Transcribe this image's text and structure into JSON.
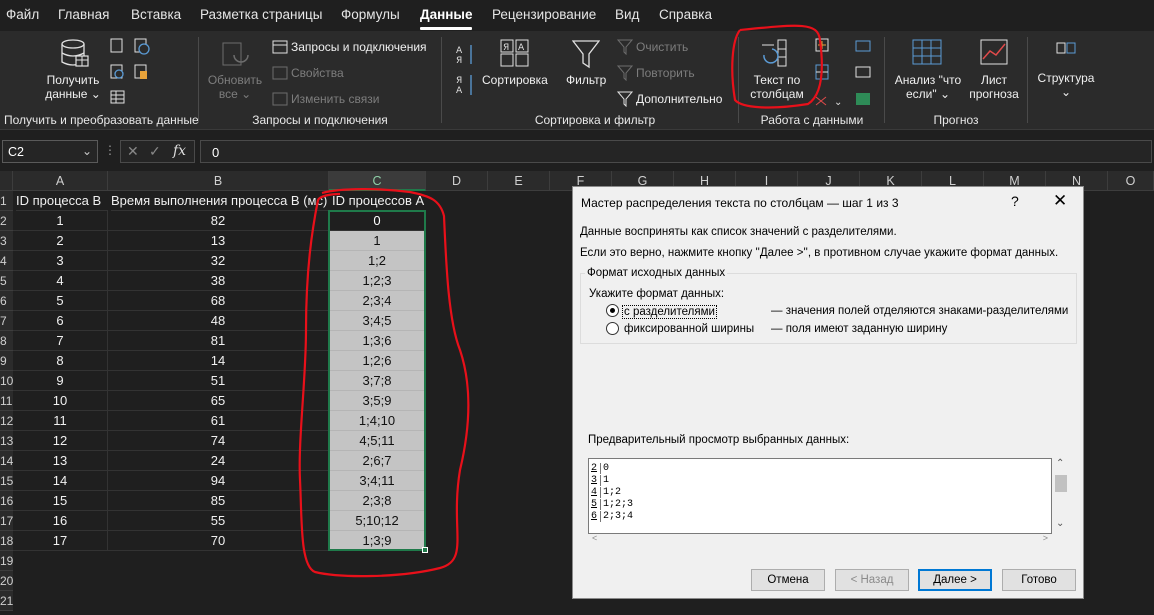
{
  "menu": {
    "tabs": [
      {
        "label": "Файл"
      },
      {
        "label": "Главная"
      },
      {
        "label": "Вставка"
      },
      {
        "label": "Разметка страницы"
      },
      {
        "label": "Формулы"
      },
      {
        "label": "Данные"
      },
      {
        "label": "Рецензирование"
      },
      {
        "label": "Вид"
      },
      {
        "label": "Справка"
      }
    ],
    "active": "Данные"
  },
  "ribbon": {
    "get_data": {
      "line1": "Получить",
      "line2": "данные",
      "group": "Получить и преобразовать данные"
    },
    "queries": {
      "refresh_line1": "Обновить",
      "refresh_line2": "все",
      "queries_connections": "Запросы и подключения",
      "properties": "Свойства",
      "edit_links": "Изменить связи",
      "group": "Запросы и подключения"
    },
    "sort_filter": {
      "sort": "Сортировка",
      "filter": "Фильтр",
      "clear": "Очистить",
      "reapply": "Повторить",
      "advanced": "Дополнительно",
      "group": "Сортировка и фильтр"
    },
    "data_tools": {
      "text_to_columns_line1": "Текст по",
      "text_to_columns_line2": "столбцам",
      "group": "Работа с данными"
    },
    "forecast": {
      "whatif_line1": "Анализ \"что",
      "whatif_line2": "если\"",
      "sheet_line1": "Лист",
      "sheet_line2": "прогноза",
      "group": "Прогноз"
    },
    "outline": {
      "label": "Структура"
    }
  },
  "formula_bar": {
    "name_box": "C2",
    "formula": "0"
  },
  "sheet": {
    "columns": [
      "A",
      "B",
      "C",
      "D",
      "E",
      "F",
      "G",
      "H",
      "I",
      "J",
      "K",
      "L",
      "M",
      "N",
      "O"
    ],
    "header_row": {
      "a": "ID процесса B",
      "b": "Время выполнения процесса B (мс)",
      "c": "ID процессов A"
    },
    "rows": [
      {
        "n": "2",
        "a": "1",
        "b": "82",
        "c": "0"
      },
      {
        "n": "3",
        "a": "2",
        "b": "13",
        "c": "1"
      },
      {
        "n": "4",
        "a": "3",
        "b": "32",
        "c": "1;2"
      },
      {
        "n": "5",
        "a": "4",
        "b": "38",
        "c": "1;2;3"
      },
      {
        "n": "6",
        "a": "5",
        "b": "68",
        "c": "2;3;4"
      },
      {
        "n": "7",
        "a": "6",
        "b": "48",
        "c": "3;4;5"
      },
      {
        "n": "8",
        "a": "7",
        "b": "81",
        "c": "1;3;6"
      },
      {
        "n": "9",
        "a": "8",
        "b": "14",
        "c": "1;2;6"
      },
      {
        "n": "10",
        "a": "9",
        "b": "51",
        "c": "3;7;8"
      },
      {
        "n": "11",
        "a": "10",
        "b": "65",
        "c": "3;5;9"
      },
      {
        "n": "12",
        "a": "11",
        "b": "61",
        "c": "1;4;10"
      },
      {
        "n": "13",
        "a": "12",
        "b": "74",
        "c": "4;5;11"
      },
      {
        "n": "14",
        "a": "13",
        "b": "24",
        "c": "2;6;7"
      },
      {
        "n": "15",
        "a": "14",
        "b": "94",
        "c": "3;4;11"
      },
      {
        "n": "16",
        "a": "15",
        "b": "85",
        "c": "2;3;8"
      },
      {
        "n": "17",
        "a": "16",
        "b": "55",
        "c": "5;10;12"
      },
      {
        "n": "18",
        "a": "17",
        "b": "70",
        "c": "1;3;9"
      }
    ],
    "empty_rows": [
      "19",
      "20",
      "21"
    ],
    "first_row": "1"
  },
  "dialog": {
    "title": "Мастер распределения текста по столбцам — шаг 1 из 3",
    "help": "?",
    "close": "✕",
    "line1": "Данные восприняты как список значений с разделителями.",
    "line2": "Если это верно, нажмите кнопку ''Далее >'', в противном случае укажите формат данных.",
    "group_label": "Формат исходных данных",
    "specify": "Укажите формат данных:",
    "opt1_label": "с разделителями",
    "opt1_desc": "— значения полей отделяются знаками-разделителями",
    "opt2_label": "фиксированной ширины",
    "opt2_desc": "— поля имеют заданную ширину",
    "preview_label": "Предварительный просмотр выбранных данных:",
    "preview": [
      {
        "n": "2",
        "text": "0"
      },
      {
        "n": "3",
        "text": "1"
      },
      {
        "n": "4",
        "text": "1;2"
      },
      {
        "n": "5",
        "text": "1;2;3"
      },
      {
        "n": "6",
        "text": "2;3;4"
      }
    ],
    "buttons": {
      "cancel": "Отмена",
      "back": "< Назад",
      "next": "Далее >",
      "finish": "Готово"
    }
  },
  "colors": {
    "accent_green": "#1f7a4a",
    "selection_gray": "#c4c4c4",
    "annotation_red": "#e8101a",
    "dialog_bg": "#f0f0f0",
    "button_focus": "#0078d4"
  }
}
